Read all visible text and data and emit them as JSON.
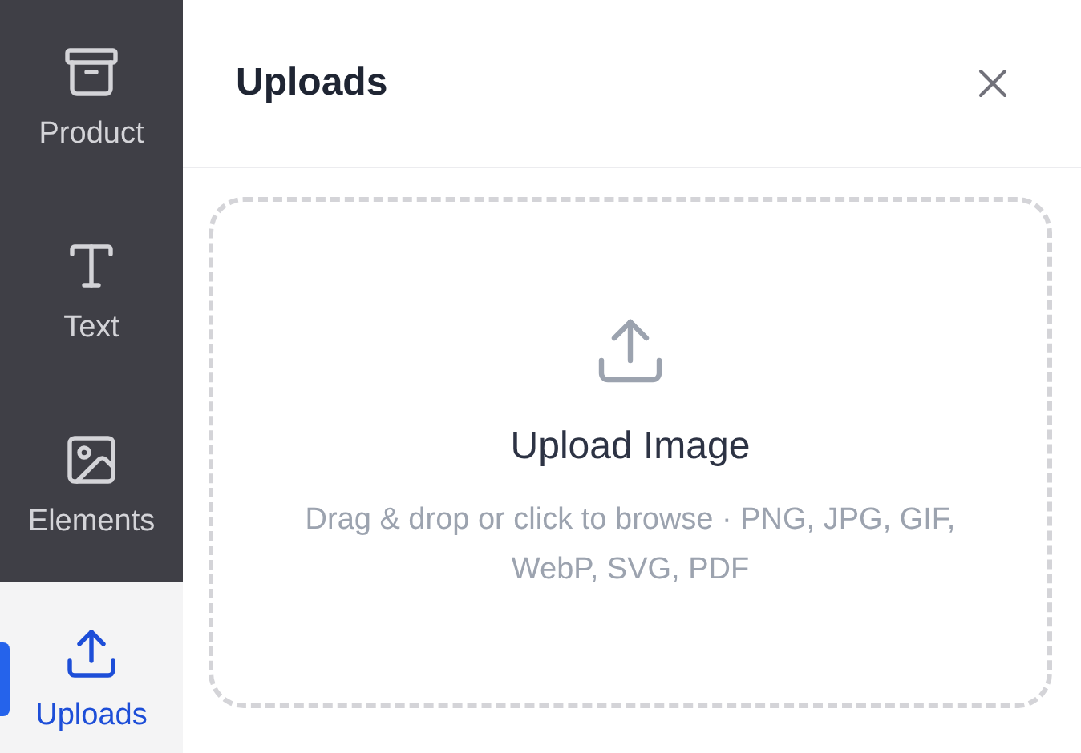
{
  "sidebar": {
    "items": [
      {
        "kind": "product",
        "label": "Product",
        "selected": false
      },
      {
        "kind": "text",
        "label": "Text",
        "selected": false
      },
      {
        "kind": "elements",
        "label": "Elements",
        "selected": false
      },
      {
        "kind": "uploads",
        "label": "Uploads",
        "selected": true
      }
    ]
  },
  "panel": {
    "title": "Uploads",
    "dropzone": {
      "title": "Upload Image",
      "hint": "Drag & drop or click to browse · PNG, JPG, GIF, WebP, SVG, PDF"
    }
  }
}
